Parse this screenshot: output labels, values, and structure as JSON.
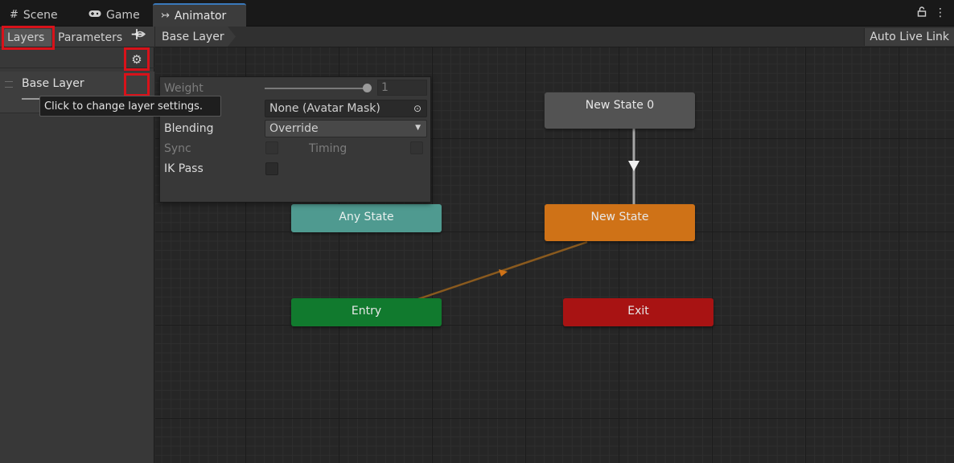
{
  "tabs": [
    {
      "label": "Scene",
      "icon": "grid-icon"
    },
    {
      "label": "Game",
      "icon": "gamepad-icon"
    },
    {
      "label": "Animator",
      "icon": "animator-icon"
    }
  ],
  "window_icons": [
    "lock-icon",
    "kebab-menu-icon"
  ],
  "left_panel": {
    "tab_layers": "Layers",
    "tab_parameters": "Parameters",
    "eye_icon": "eye-icon",
    "add_icon": "plus-icon",
    "layer": {
      "name": "Base Layer",
      "settings_icon": "gear-icon"
    },
    "tooltip": "Click to change layer settings."
  },
  "graph": {
    "breadcrumb": "Base Layer",
    "live_link": "Auto Live Link"
  },
  "layer_settings": {
    "weight_label": "Weight",
    "weight_value": "1",
    "mask_value": "None (Avatar Mask)",
    "blending_label": "Blending",
    "blending_value": "Override",
    "sync_label": "Sync",
    "timing_label": "Timing",
    "ik_label": "IK Pass"
  },
  "nodes": {
    "new_state_0": "New State 0",
    "new_state": "New State",
    "any_state": "Any State",
    "entry": "Entry",
    "exit": "Exit"
  },
  "colors": {
    "default_state": "#cf7217",
    "any_state": "#4f9a90",
    "entry": "#117a2e",
    "exit": "#a81313",
    "highlight": "#d8121a"
  }
}
